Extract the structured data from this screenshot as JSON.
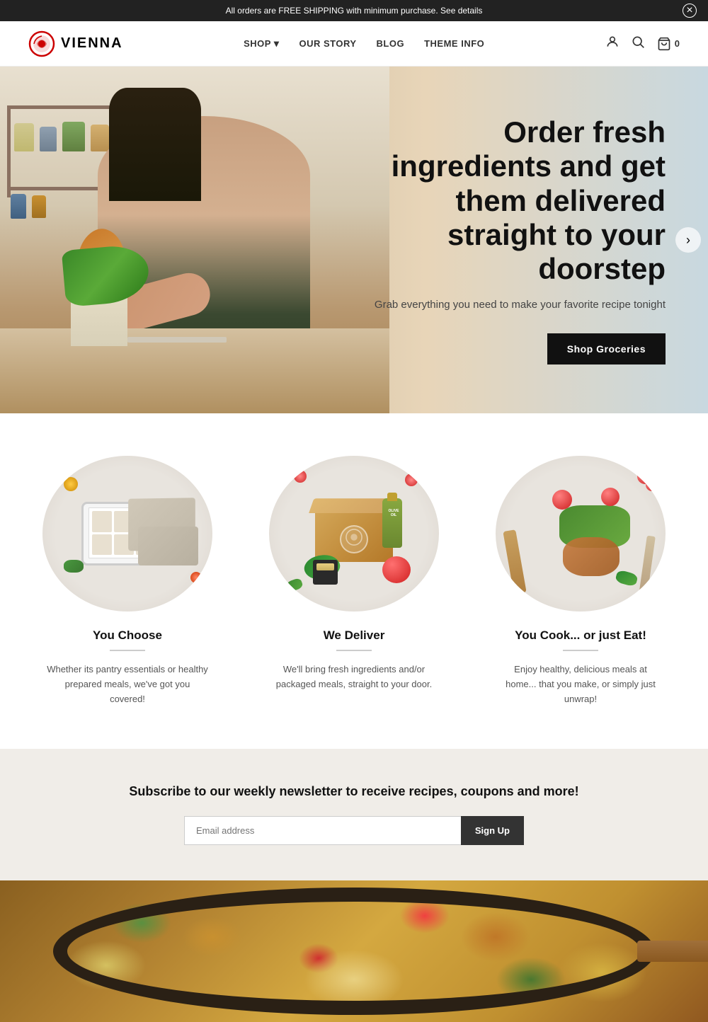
{
  "announcement": {
    "text": "All orders are FREE SHIPPING with minimum purchase. See details",
    "close_label": "×"
  },
  "header": {
    "logo_text": "VIENNA",
    "nav": {
      "shop_label": "SHOP",
      "our_story_label": "OUR STORY",
      "blog_label": "BLOG",
      "theme_info_label": "THEME INFO"
    },
    "cart_label": "0"
  },
  "hero": {
    "title": "Order fresh ingredients and get them delivered straight to your doorstep",
    "subtitle": "Grab everything you need to make your favorite recipe tonight",
    "cta_label": "Shop Groceries"
  },
  "features": {
    "items": [
      {
        "title": "You Choose",
        "description": "Whether its pantry essentials or healthy prepared meals, we've got you covered!"
      },
      {
        "title": "We Deliver",
        "description": "We'll bring fresh ingredients and/or packaged meals, straight to your door."
      },
      {
        "title": "You Cook... or just Eat!",
        "description": "Enjoy healthy, delicious meals at home... that you make, or simply just unwrap!"
      }
    ]
  },
  "newsletter": {
    "title": "Subscribe to our weekly newsletter to receive recipes, coupons and more!",
    "email_placeholder": "Email address",
    "signup_label": "Sign Up"
  }
}
